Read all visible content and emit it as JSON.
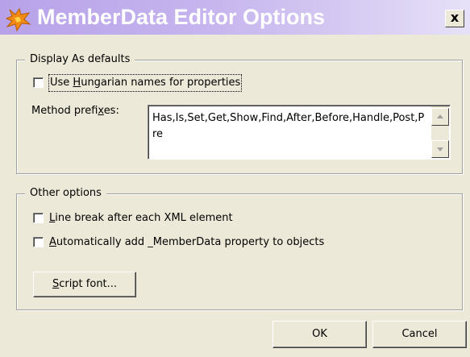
{
  "window": {
    "title": "MemberData Editor Options",
    "close_label": "x",
    "app_icon": "fox-icon"
  },
  "display_defaults": {
    "legend": "Display As defaults",
    "hungarian": {
      "label_before": "Use ",
      "label_accel": "H",
      "label_after": "ungarian names for properties",
      "checked": false
    },
    "method_prefixes": {
      "label_before": "Method prefi",
      "label_accel": "x",
      "label_after": "es:",
      "value": "Has,Is,Set,Get,Show,Find,After,Before,Handle,Post,Pre"
    }
  },
  "other_options": {
    "legend": "Other options",
    "line_break": {
      "label_accel": "L",
      "label_after": "ine break after each XML element",
      "checked": false
    },
    "auto_add": {
      "label_accel": "A",
      "label_after": "utomatically add _MemberData property to objects",
      "checked": false
    },
    "script_font_button": {
      "label_accel": "S",
      "label_after": "cript font..."
    }
  },
  "buttons": {
    "ok": "OK",
    "cancel": "Cancel"
  }
}
